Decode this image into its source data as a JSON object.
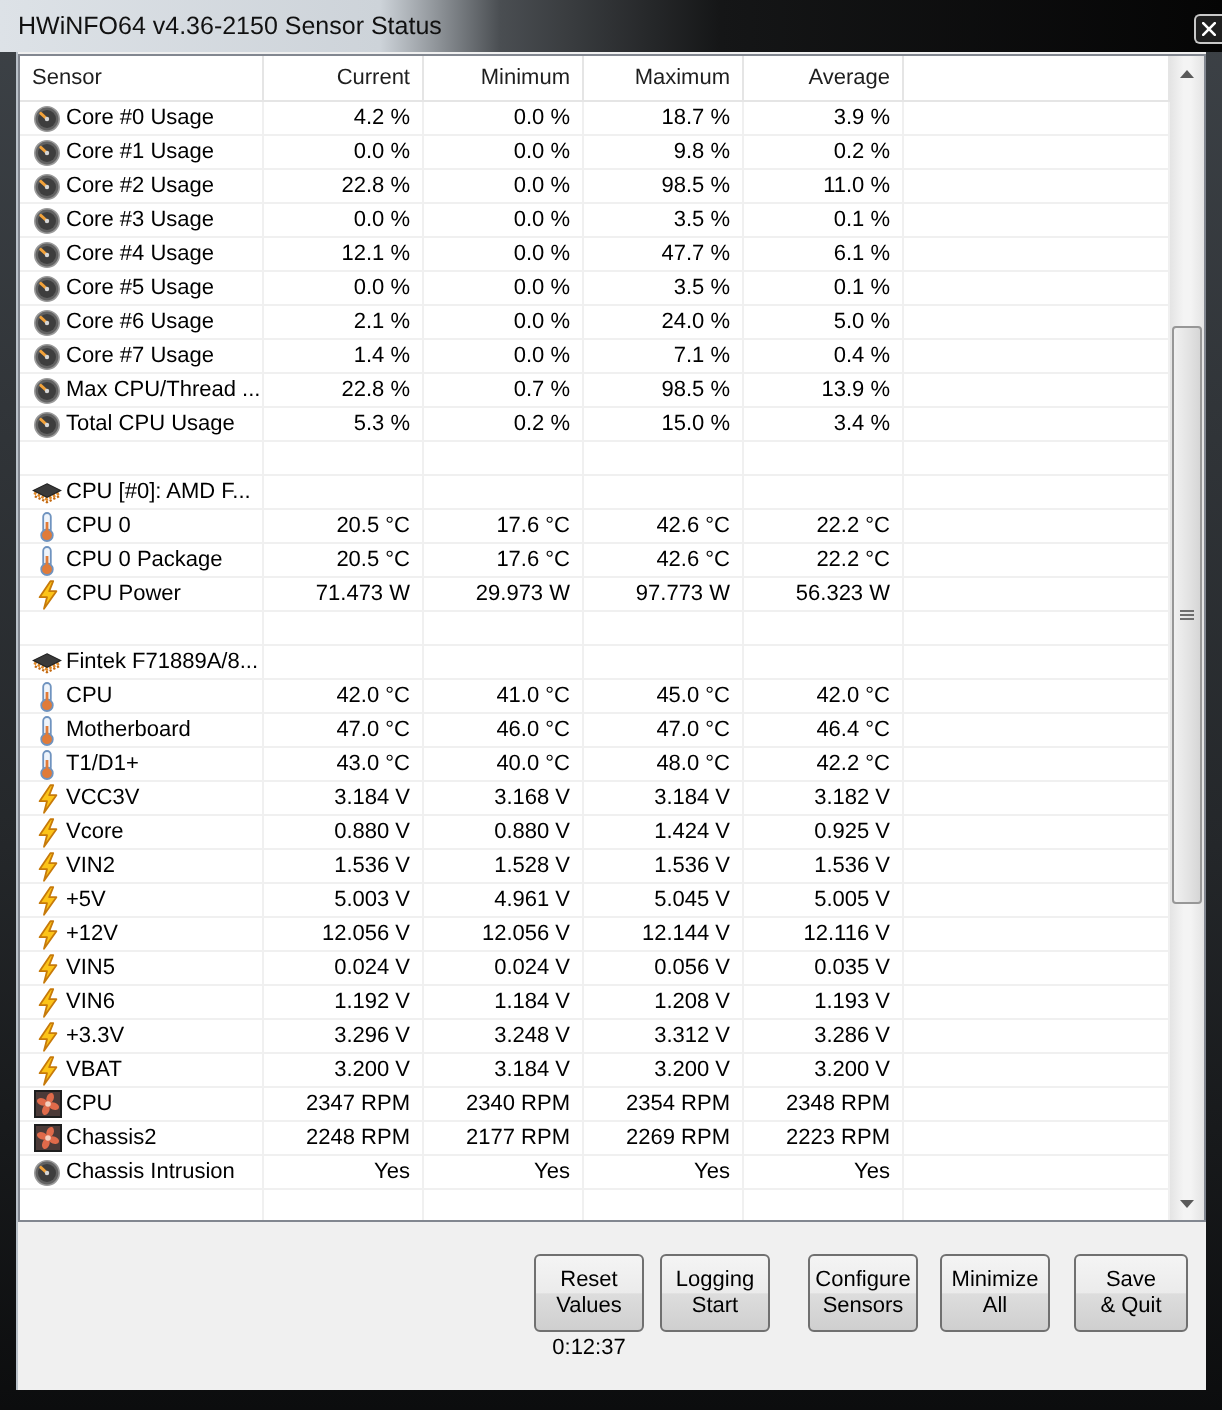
{
  "window": {
    "title": "HWiNFO64 v4.36-2150 Sensor Status"
  },
  "table": {
    "columns": [
      "Sensor",
      "Current",
      "Minimum",
      "Maximum",
      "Average"
    ],
    "rows": [
      {
        "kind": "gauge",
        "sensor": "Core #0 Usage",
        "current": "4.2 %",
        "minimum": "0.0 %",
        "maximum": "18.7 %",
        "average": "3.9 %"
      },
      {
        "kind": "gauge",
        "sensor": "Core #1 Usage",
        "current": "0.0 %",
        "minimum": "0.0 %",
        "maximum": "9.8 %",
        "average": "0.2 %"
      },
      {
        "kind": "gauge",
        "sensor": "Core #2 Usage",
        "current": "22.8 %",
        "minimum": "0.0 %",
        "maximum": "98.5 %",
        "average": "11.0 %"
      },
      {
        "kind": "gauge",
        "sensor": "Core #3 Usage",
        "current": "0.0 %",
        "minimum": "0.0 %",
        "maximum": "3.5 %",
        "average": "0.1 %"
      },
      {
        "kind": "gauge",
        "sensor": "Core #4 Usage",
        "current": "12.1 %",
        "minimum": "0.0 %",
        "maximum": "47.7 %",
        "average": "6.1 %"
      },
      {
        "kind": "gauge",
        "sensor": "Core #5 Usage",
        "current": "0.0 %",
        "minimum": "0.0 %",
        "maximum": "3.5 %",
        "average": "0.1 %"
      },
      {
        "kind": "gauge",
        "sensor": "Core #6 Usage",
        "current": "2.1 %",
        "minimum": "0.0 %",
        "maximum": "24.0 %",
        "average": "5.0 %"
      },
      {
        "kind": "gauge",
        "sensor": "Core #7 Usage",
        "current": "1.4 %",
        "minimum": "0.0 %",
        "maximum": "7.1 %",
        "average": "0.4 %"
      },
      {
        "kind": "gauge",
        "sensor": "Max CPU/Thread ...",
        "current": "22.8 %",
        "minimum": "0.7 %",
        "maximum": "98.5 %",
        "average": "13.9 %"
      },
      {
        "kind": "gauge",
        "sensor": "Total CPU Usage",
        "current": "5.3 %",
        "minimum": "0.2 %",
        "maximum": "15.0 %",
        "average": "3.4 %"
      },
      {
        "kind": "spacer"
      },
      {
        "kind": "device",
        "sensor": "CPU [#0]: AMD F..."
      },
      {
        "kind": "temperature",
        "sensor": "CPU 0",
        "current": "20.5 °C",
        "minimum": "17.6 °C",
        "maximum": "42.6 °C",
        "average": "22.2 °C"
      },
      {
        "kind": "temperature",
        "sensor": "CPU 0 Package",
        "current": "20.5 °C",
        "minimum": "17.6 °C",
        "maximum": "42.6 °C",
        "average": "22.2 °C"
      },
      {
        "kind": "electrical",
        "sensor": "CPU Power",
        "current": "71.473 W",
        "minimum": "29.973 W",
        "maximum": "97.773 W",
        "average": "56.323 W"
      },
      {
        "kind": "spacer"
      },
      {
        "kind": "device",
        "sensor": "Fintek F71889A/8..."
      },
      {
        "kind": "temperature",
        "sensor": "CPU",
        "current": "42.0 °C",
        "minimum": "41.0 °C",
        "maximum": "45.0 °C",
        "average": "42.0 °C"
      },
      {
        "kind": "temperature",
        "sensor": "Motherboard",
        "current": "47.0 °C",
        "minimum": "46.0 °C",
        "maximum": "47.0 °C",
        "average": "46.4 °C"
      },
      {
        "kind": "temperature",
        "sensor": "T1/D1+",
        "current": "43.0 °C",
        "minimum": "40.0 °C",
        "maximum": "48.0 °C",
        "average": "42.2 °C"
      },
      {
        "kind": "electrical",
        "sensor": "VCC3V",
        "current": "3.184 V",
        "minimum": "3.168 V",
        "maximum": "3.184 V",
        "average": "3.182 V"
      },
      {
        "kind": "electrical",
        "sensor": "Vcore",
        "current": "0.880 V",
        "minimum": "0.880 V",
        "maximum": "1.424 V",
        "average": "0.925 V"
      },
      {
        "kind": "electrical",
        "sensor": "VIN2",
        "current": "1.536 V",
        "minimum": "1.528 V",
        "maximum": "1.536 V",
        "average": "1.536 V"
      },
      {
        "kind": "electrical",
        "sensor": "+5V",
        "current": "5.003 V",
        "minimum": "4.961 V",
        "maximum": "5.045 V",
        "average": "5.005 V"
      },
      {
        "kind": "electrical",
        "sensor": "+12V",
        "current": "12.056 V",
        "minimum": "12.056 V",
        "maximum": "12.144 V",
        "average": "12.116 V"
      },
      {
        "kind": "electrical",
        "sensor": "VIN5",
        "current": "0.024 V",
        "minimum": "0.024 V",
        "maximum": "0.056 V",
        "average": "0.035 V"
      },
      {
        "kind": "electrical",
        "sensor": "VIN6",
        "current": "1.192 V",
        "minimum": "1.184 V",
        "maximum": "1.208 V",
        "average": "1.193 V"
      },
      {
        "kind": "electrical",
        "sensor": "+3.3V",
        "current": "3.296 V",
        "minimum": "3.248 V",
        "maximum": "3.312 V",
        "average": "3.286 V"
      },
      {
        "kind": "electrical",
        "sensor": "VBAT",
        "current": "3.200 V",
        "minimum": "3.184 V",
        "maximum": "3.200 V",
        "average": "3.200 V"
      },
      {
        "kind": "fan",
        "sensor": "CPU",
        "current": "2347 RPM",
        "minimum": "2340 RPM",
        "maximum": "2354 RPM",
        "average": "2348 RPM"
      },
      {
        "kind": "fan",
        "sensor": "Chassis2",
        "current": "2248 RPM",
        "minimum": "2177 RPM",
        "maximum": "2269 RPM",
        "average": "2223 RPM"
      },
      {
        "kind": "gauge",
        "sensor": "Chassis Intrusion",
        "current": "Yes",
        "minimum": "Yes",
        "maximum": "Yes",
        "average": "Yes"
      }
    ]
  },
  "footer": {
    "buttons": [
      "Reset\nValues",
      "Logging\nStart",
      "Configure\nSensors",
      "Minimize\nAll",
      "Save\n& Quit"
    ],
    "elapsed_time": "0:12:37"
  }
}
